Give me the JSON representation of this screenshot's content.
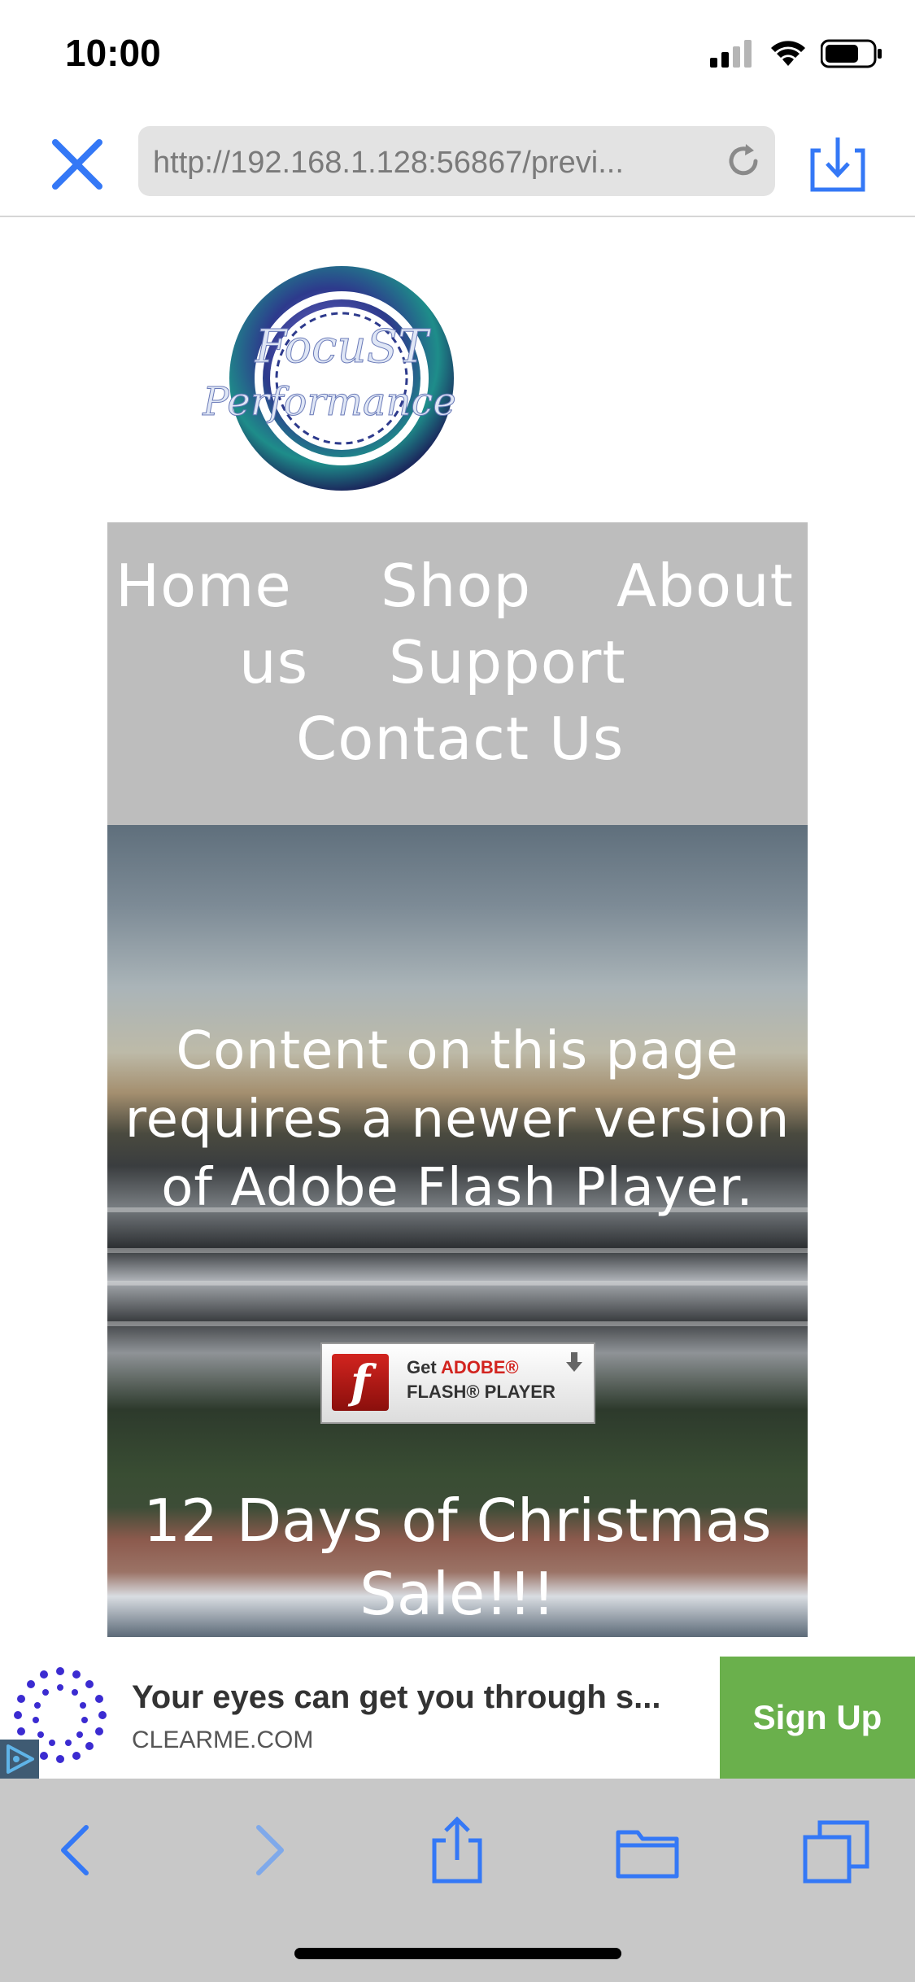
{
  "status_bar": {
    "time": "10:00"
  },
  "browser": {
    "url": "http://192.168.1.128:56867/previ...",
    "icons": {
      "close": "close-icon",
      "reload": "reload-icon",
      "download": "download-icon"
    },
    "accent_color": "#3478f6"
  },
  "page": {
    "logo_alt": "FocuST Performance",
    "nav": {
      "home": "Home",
      "shop": "Shop",
      "about": "About",
      "about_cont": "us",
      "support": "Support",
      "contact": "Contact Us"
    },
    "flash_message": "Content on this page requires a newer version of Adobe Flash Player.",
    "flash_badge": {
      "get": "Get",
      "adobe": "ADOBE®",
      "player": "FLASH® PLAYER"
    },
    "sale_text": "12 Days of Christmas Sale!!!"
  },
  "ad": {
    "title": "Your eyes can get you through s...",
    "domain": "CLEARME.COM",
    "button": "Sign Up",
    "button_color": "#6ab04c"
  },
  "toolbar": {
    "icons": [
      "back-icon",
      "forward-icon",
      "share-icon",
      "bookmarks-icon",
      "tabs-icon"
    ]
  }
}
